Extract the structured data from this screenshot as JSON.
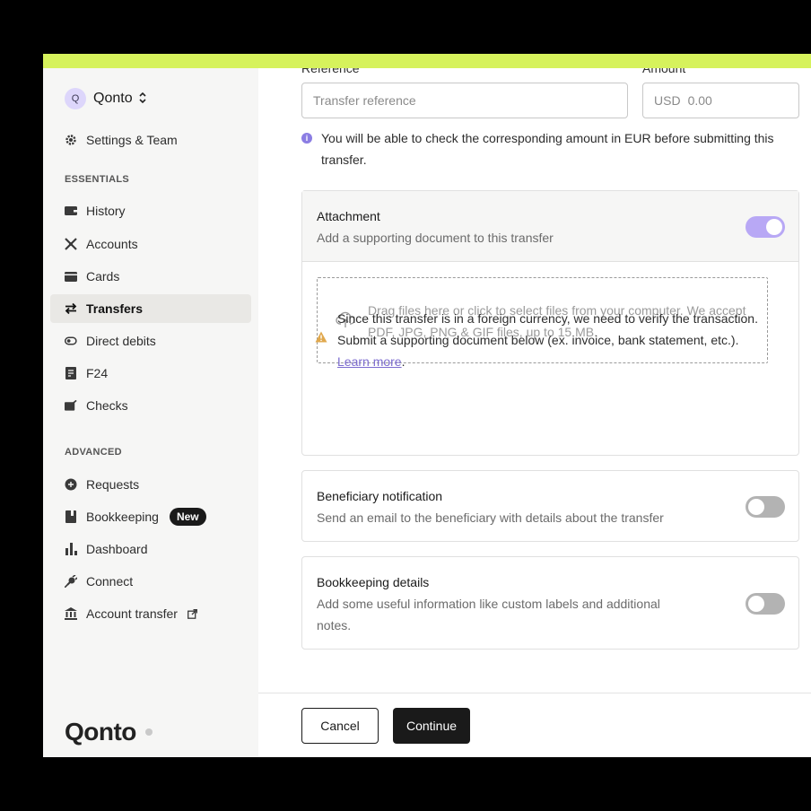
{
  "colors": {
    "accent": "#d6f25c",
    "brand_purple": "#8b7de3",
    "toggle_on": "#b8a8f5",
    "warning": "#e0a84d"
  },
  "sidebar": {
    "org": {
      "avatar_letter": "Q",
      "name": "Qonto",
      "chevron": "⌃⌄"
    },
    "settings": {
      "label": "Settings & Team",
      "icon": "gear-icon"
    },
    "sections": {
      "essentials": "ESSENTIALS",
      "advanced": "ADVANCED"
    },
    "essentials": [
      {
        "label": "History",
        "icon": "wallet-icon"
      },
      {
        "label": "Accounts",
        "icon": "accounts-icon"
      },
      {
        "label": "Cards",
        "icon": "card-icon"
      },
      {
        "label": "Transfers",
        "icon": "transfer-arrows-icon",
        "active": true
      },
      {
        "label": "Direct debits",
        "icon": "direct-debit-icon"
      },
      {
        "label": "F24",
        "icon": "f24-icon"
      },
      {
        "label": "Checks",
        "icon": "check-icon"
      }
    ],
    "advanced": [
      {
        "label": "Requests",
        "icon": "requests-icon"
      },
      {
        "label": "Bookkeeping",
        "icon": "bookkeeping-icon",
        "badge": "New"
      },
      {
        "label": "Dashboard",
        "icon": "bar-chart-icon"
      },
      {
        "label": "Connect",
        "icon": "plug-icon"
      },
      {
        "label": "Account transfer",
        "icon": "bank-icon",
        "external": "↗"
      }
    ],
    "brand": "Qonto"
  },
  "form": {
    "reference": {
      "label": "Reference",
      "placeholder": "Transfer reference"
    },
    "amount": {
      "label": "Amount",
      "currency": "USD",
      "placeholder": "0.00"
    },
    "info_text": "You will be able to check the corresponding amount in EUR before submitting this transfer.",
    "attachment": {
      "title": "Attachment",
      "subtitle": "Add a supporting document to this transfer",
      "toggle_on": true,
      "dropzone_text": "Drag files here or click to select files from your computer. We accept PDF, JPG, PNG & GIF files, up to 15 MB.",
      "warning_text": "Since this transfer is in a foreign currency, we need to verify the transaction. Submit a supporting document below (ex. invoice, bank statement, etc.).",
      "learn_more": "Learn more",
      "period": "."
    },
    "beneficiary": {
      "title": "Beneficiary notification",
      "subtitle": "Send an email to the beneficiary with details about the transfer",
      "toggle_on": false
    },
    "bookkeeping": {
      "title": "Bookkeeping details",
      "subtitle": "Add some useful information like custom labels and additional notes.",
      "toggle_on": false
    }
  },
  "footer": {
    "cancel": "Cancel",
    "continue": "Continue"
  }
}
